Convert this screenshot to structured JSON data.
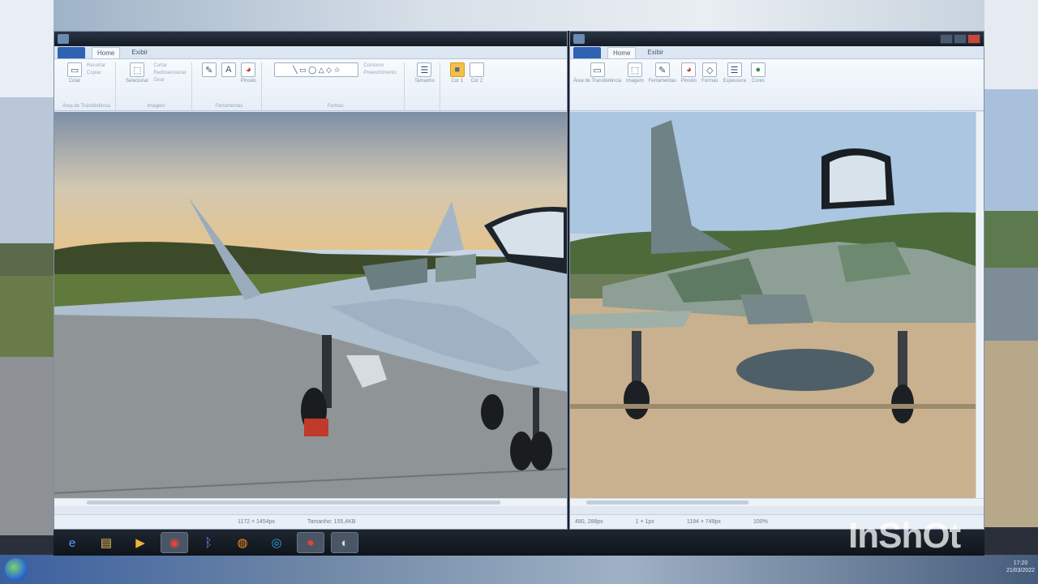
{
  "left_window": {
    "tabs": [
      "Home",
      "Exibir"
    ],
    "ribbon": {
      "clipboard": {
        "label": "Área de Transferência",
        "paste": "Colar",
        "cut": "Recortar",
        "copy": "Copiar"
      },
      "image": {
        "label": "Imagem",
        "select": "Selecionar",
        "crop": "Cortar",
        "resize": "Redimensionar",
        "rotate": "Girar"
      },
      "tools": {
        "label": "Ferramentas"
      },
      "brushes": "Pincéis",
      "shapes": {
        "label": "Formas",
        "outline": "Contorno",
        "fill": "Preenchimento"
      },
      "size": "Tamanho",
      "color1": "Cor 1",
      "color2": "Cor 2"
    },
    "status": {
      "dimensions": "1172 × 1454px",
      "size": "Tamanho: 155,4KB"
    }
  },
  "right_window": {
    "tabs": [
      "Home",
      "Exibir"
    ],
    "ribbon": {
      "clipboard": "Área de Transferência",
      "image": "Imagem",
      "tools": "Ferramentas",
      "brushes": "Pincéis",
      "shapes": "Formas",
      "size": "Espessura",
      "colors": "Cores"
    },
    "status": {
      "cursor": "480, 288px",
      "selection": "1 × 1px",
      "dimensions": "1194 × 749px",
      "zoom": "100%"
    }
  },
  "taskbar": {
    "items": [
      "ie-icon",
      "folder-icon",
      "media-player-icon",
      "chrome-icon",
      "bluetooth-icon",
      "firefox-icon",
      "edge-icon",
      "screen-recorder-icon",
      "paint-icon"
    ]
  },
  "watermark": "InShOt",
  "clock": {
    "time": "17:20",
    "date": "21/03/2022"
  },
  "colors": {
    "ribbon_bg": "#e6eef7",
    "title_bg": "#151b24",
    "active_tool": "#f4c04a"
  }
}
